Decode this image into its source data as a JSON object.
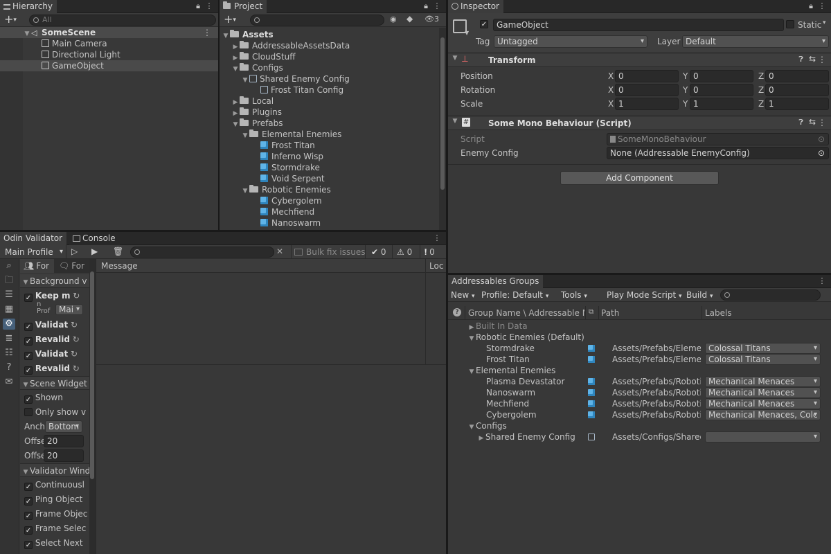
{
  "hierarchy": {
    "tab": "Hierarchy",
    "search_placeholder": "All",
    "items": [
      {
        "label": "SomeScene"
      },
      {
        "label": "Main Camera"
      },
      {
        "label": "Directional Light"
      },
      {
        "label": "GameObject"
      }
    ]
  },
  "project": {
    "tab": "Project",
    "hidden_count": "3",
    "items": [
      {
        "label": "Assets"
      },
      {
        "label": "AddressableAssetsData"
      },
      {
        "label": "CloudStuff"
      },
      {
        "label": "Configs"
      },
      {
        "label": "Shared Enemy Config"
      },
      {
        "label": "Frost Titan Config"
      },
      {
        "label": "Local"
      },
      {
        "label": "Plugins"
      },
      {
        "label": "Prefabs"
      },
      {
        "label": "Elemental Enemies"
      },
      {
        "label": "Frost Titan"
      },
      {
        "label": "Inferno Wisp"
      },
      {
        "label": "Stormdrake"
      },
      {
        "label": "Void Serpent"
      },
      {
        "label": "Robotic Enemies"
      },
      {
        "label": "Cybergolem"
      },
      {
        "label": "Mechfiend"
      },
      {
        "label": "Nanoswarm"
      }
    ]
  },
  "inspector": {
    "tab": "Inspector",
    "object_name": "GameObject",
    "static_label": "Static",
    "tag_label": "Tag",
    "tag_value": "Untagged",
    "layer_label": "Layer",
    "layer_value": "Default",
    "transform": {
      "title": "Transform",
      "rows": [
        {
          "label": "Position",
          "x": "0",
          "y": "0",
          "z": "0"
        },
        {
          "label": "Rotation",
          "x": "0",
          "y": "0",
          "z": "0"
        },
        {
          "label": "Scale",
          "x": "1",
          "y": "1",
          "z": "1"
        }
      ],
      "x_label": "X",
      "y_label": "Y",
      "z_label": "Z"
    },
    "script_component": {
      "title": "Some Mono Behaviour (Script)",
      "script_label": "Script",
      "script_value": "SomeMonoBehaviour",
      "config_label": "Enemy Config",
      "config_value": "None (Addressable EnemyConfig)"
    },
    "add_component": "Add Component"
  },
  "validator": {
    "tab1": "Odin Validator",
    "tab2": "Console",
    "profile": "Main Profile",
    "bulk_fix": "Bulk fix issues",
    "count_ok": "0",
    "count_warn": "0",
    "count_err": "0",
    "sub_tab1": "For",
    "sub_tab2": "For",
    "col_message": "Message",
    "col_loc": "Loc",
    "sections": {
      "background": "Background v",
      "scene_widget": "Scene Widget",
      "validator_window": "Validator Wind"
    },
    "bg_items": [
      "Keep m",
      "Validat",
      "Revalid",
      "Validat",
      "Revalid"
    ],
    "profile_label": "n Prof",
    "profile_dd": "Mai",
    "scene_shown": "Shown",
    "scene_only": "Only show v",
    "anchor_label": "Anch",
    "anchor_value": "Bottom",
    "offset_label": "Offse",
    "offset1": "20",
    "offset2": "20",
    "window_items": [
      "Continuousl",
      "Ping Object",
      "Frame Objec",
      "Frame Selec",
      "Select Next"
    ]
  },
  "addressables": {
    "tab": "Addressables Groups",
    "toolbar": {
      "new": "New",
      "profile": "Profile: Default",
      "tools": "Tools",
      "play_mode": "Play Mode Script",
      "build": "Build"
    },
    "columns": {
      "name": "Group Name \\ Addressable Na",
      "path": "Path",
      "labels": "Labels"
    },
    "rows": [
      {
        "name": "Built In Data",
        "path": "",
        "labels": ""
      },
      {
        "name": "Robotic Enemies (Default)",
        "path": "",
        "labels": ""
      },
      {
        "name": "Stormdrake",
        "path": "Assets/Prefabs/Elemen",
        "labels": "Colossal Titans"
      },
      {
        "name": "Frost Titan",
        "path": "Assets/Prefabs/Elemen",
        "labels": "Colossal Titans"
      },
      {
        "name": "Elemental Enemies",
        "path": "",
        "labels": ""
      },
      {
        "name": "Plasma Devastator",
        "path": "Assets/Prefabs/Robotic",
        "labels": "Mechanical Menaces"
      },
      {
        "name": "Nanoswarm",
        "path": "Assets/Prefabs/Robotic",
        "labels": "Mechanical Menaces"
      },
      {
        "name": "Mechfiend",
        "path": "Assets/Prefabs/Robotic",
        "labels": "Mechanical Menaces"
      },
      {
        "name": "Cybergolem",
        "path": "Assets/Prefabs/Robotic",
        "labels": "Mechanical Menaces, Colc"
      },
      {
        "name": "Configs",
        "path": "",
        "labels": ""
      },
      {
        "name": "Shared Enemy Config",
        "path": "Assets/Configs/Shared",
        "labels": ""
      }
    ]
  }
}
